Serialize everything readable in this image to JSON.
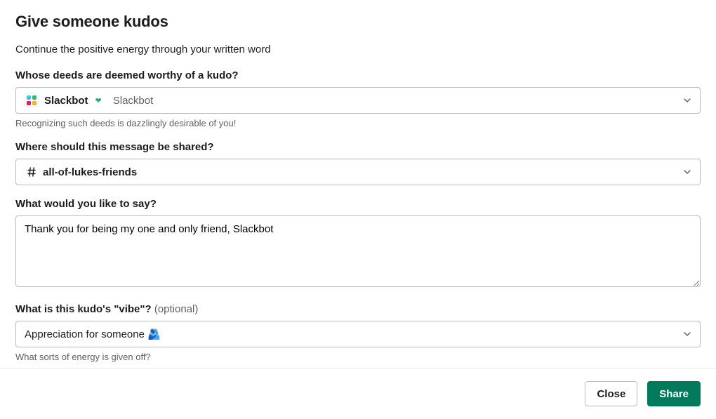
{
  "header": {
    "title": "Give someone kudos",
    "subtitle": "Continue the positive energy through your written word"
  },
  "fields": {
    "who": {
      "label": "Whose deeds are deemed worthy of a kudo?",
      "helper": "Recognizing such deeds is dazzlingly desirable of you!",
      "selected": {
        "display_name": "Slackbot",
        "real_name": "Slackbot"
      }
    },
    "where": {
      "label": "Where should this message be shared?",
      "selected": {
        "channel_name": "all-of-lukes-friends"
      }
    },
    "message": {
      "label": "What would you like to say?",
      "value": "Thank you for being my one and only friend, Slackbot"
    },
    "vibe": {
      "label": "What is this kudo's \"vibe\"?",
      "optional_text": " (optional)",
      "selected": {
        "text": "Appreciation for someone",
        "emoji": "🫂"
      },
      "helper": "What sorts of energy is given off?"
    }
  },
  "footer": {
    "close_label": "Close",
    "share_label": "Share"
  }
}
